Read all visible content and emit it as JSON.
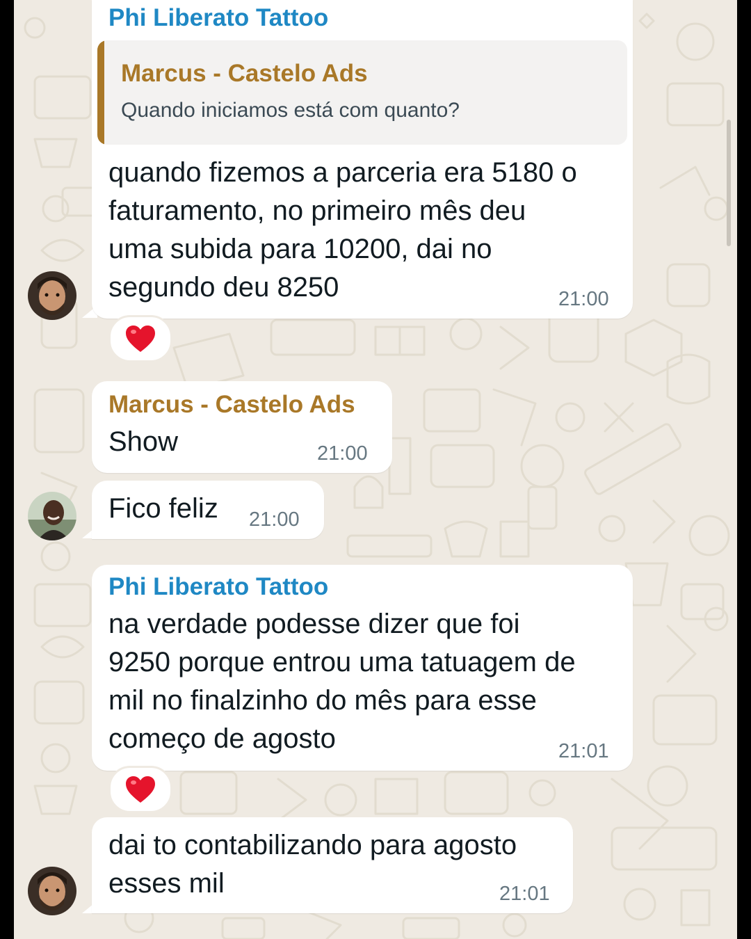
{
  "colors": {
    "chat_background": "#efeae2",
    "bubble": "#ffffff",
    "sender_phi": "#1f88c4",
    "sender_marcus": "#a97828",
    "timestamp": "#667781",
    "heart": "#e5142c"
  },
  "messages": [
    {
      "sender": "Phi Liberato Tattoo",
      "quoted": {
        "author": "Marcus - Castelo Ads",
        "text": "Quando iniciamos está com quanto?"
      },
      "text": "quando fizemos a parceria era 5180 o\nfaturamento, no primeiro mês deu\numa subida para 10200, dai no\nsegundo deu 8250",
      "time": "21:00",
      "reaction": "heart-icon"
    },
    {
      "sender": "Marcus - Castelo Ads",
      "text": "Show",
      "time": "21:00"
    },
    {
      "text": "Fico feliz",
      "time": "21:00"
    },
    {
      "sender": "Phi Liberato Tattoo",
      "text": "na verdade podesse dizer que foi\n9250 porque entrou uma tatuagem de\nmil no finalzinho do mês para esse\ncomeço de agosto",
      "time": "21:01",
      "reaction": "heart-icon"
    },
    {
      "text": "dai to contabilizando para agosto\nesses mil",
      "time": "21:01"
    }
  ]
}
